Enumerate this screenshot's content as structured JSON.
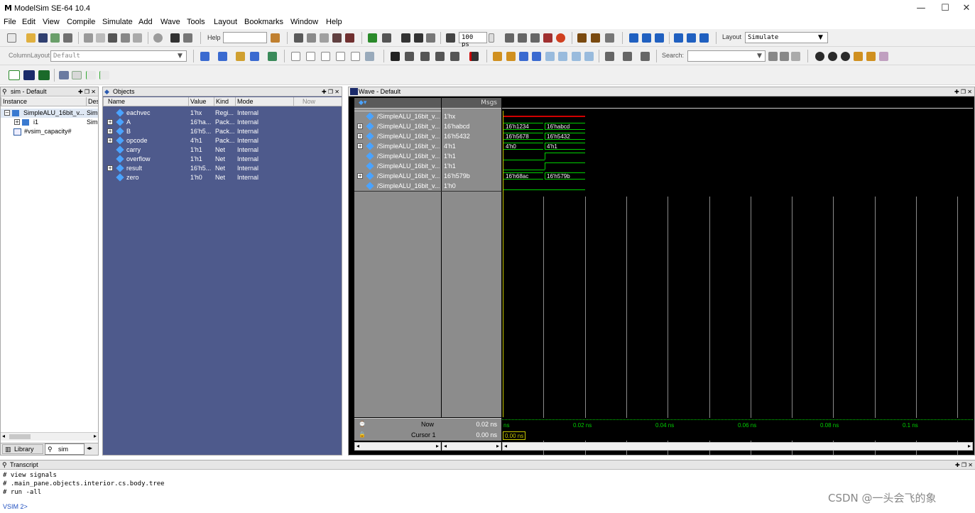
{
  "app": {
    "title": "ModelSim SE-64 10.4",
    "minimize": "—",
    "maximize": "☐",
    "close": "✕",
    "icon_letter": "M"
  },
  "menu": [
    "File",
    "Edit",
    "View",
    "Compile",
    "Simulate",
    "Add",
    "Wave",
    "Tools",
    "Layout",
    "Bookmarks",
    "Window",
    "Help"
  ],
  "toolbar": {
    "help_label": "Help",
    "run_length": "100 ps",
    "layout_label": "Layout",
    "layout_value": "Simulate",
    "column_layout_label": "ColumnLayout",
    "column_layout_value": "Default",
    "search_label": "Search:"
  },
  "sim_pane": {
    "title": "sim - Default",
    "headers": [
      "Instance",
      "Des"
    ],
    "rows": [
      {
        "name": "SimpleALU_16bit_v...",
        "design": "Sim"
      },
      {
        "name": "i1",
        "design": "Sim"
      },
      {
        "name": "#vsim_capacity#",
        "design": ""
      }
    ],
    "tabs": [
      "Library",
      "sim"
    ]
  },
  "objects_pane": {
    "title": "Objects",
    "headers": [
      "Name",
      "Value",
      "Kind",
      "Mode"
    ],
    "now_label": "Now",
    "rows": [
      {
        "name": "eachvec",
        "value": "1'hx",
        "kind": "Regi...",
        "mode": "Internal",
        "expand": false
      },
      {
        "name": "A",
        "value": "16'ha...",
        "kind": "Pack...",
        "mode": "Internal",
        "expand": true
      },
      {
        "name": "B",
        "value": "16'h5...",
        "kind": "Pack...",
        "mode": "Internal",
        "expand": true
      },
      {
        "name": "opcode",
        "value": "4'h1",
        "kind": "Pack...",
        "mode": "Internal",
        "expand": true
      },
      {
        "name": "carry",
        "value": "1'h1",
        "kind": "Net",
        "mode": "Internal",
        "expand": false
      },
      {
        "name": "overflow",
        "value": "1'h1",
        "kind": "Net",
        "mode": "Internal",
        "expand": false
      },
      {
        "name": "result",
        "value": "16'h5...",
        "kind": "Net",
        "mode": "Internal",
        "expand": true
      },
      {
        "name": "zero",
        "value": "1'h0",
        "kind": "Net",
        "mode": "Internal",
        "expand": false
      }
    ]
  },
  "wave_pane": {
    "title": "Wave - Default",
    "msgs_label": "Msgs",
    "signals": [
      {
        "name": "/SimpleALU_16bit_v...",
        "value": "1'hx",
        "expand": false
      },
      {
        "name": "/SimpleALU_16bit_v...",
        "value": "16'habcd",
        "expand": true
      },
      {
        "name": "/SimpleALU_16bit_v...",
        "value": "16'h5432",
        "expand": true
      },
      {
        "name": "/SimpleALU_16bit_v...",
        "value": "4'h1",
        "expand": true
      },
      {
        "name": "/SimpleALU_16bit_v...",
        "value": "1'h1",
        "expand": false
      },
      {
        "name": "/SimpleALU_16bit_v...",
        "value": "1'h1",
        "expand": false
      },
      {
        "name": "/SimpleALU_16bit_v...",
        "value": "16'h579b",
        "expand": true
      },
      {
        "name": "/SimpleALU_16bit_v...",
        "value": "1'h0",
        "expand": false
      }
    ],
    "bus_values": [
      {
        "before": "16'h1234",
        "after": "16'habcd"
      },
      {
        "before": "16'h5678",
        "after": "16'h5432"
      },
      {
        "before": "4'h0",
        "after": "4'h1"
      },
      {
        "before": "16'h68ac",
        "after": "16'h579b"
      }
    ],
    "now_label": "Now",
    "now_value": "0.02 ns",
    "cursor_label": "Cursor 1",
    "cursor_value": "0.00 ns",
    "cursor_box": "0.00 ns",
    "timeline_ticks": [
      "ns",
      "0.02 ns",
      "0.04 ns",
      "0.06 ns",
      "0.08 ns",
      "0.1 ns"
    ]
  },
  "transcript": {
    "title": "Transcript",
    "lines": [
      "# view signals",
      "# .main_pane.objects.interior.cs.body.tree",
      "# run -all"
    ],
    "prompt": "VSIM 2>"
  },
  "watermark": "CSDN @一头会飞的象",
  "colors": {
    "wave_bg": "#000000",
    "wave_green": "#00d000",
    "wave_red": "#d00000",
    "objects_bg": "#4e5a8c",
    "wave_names_bg": "#8c8c8c"
  }
}
